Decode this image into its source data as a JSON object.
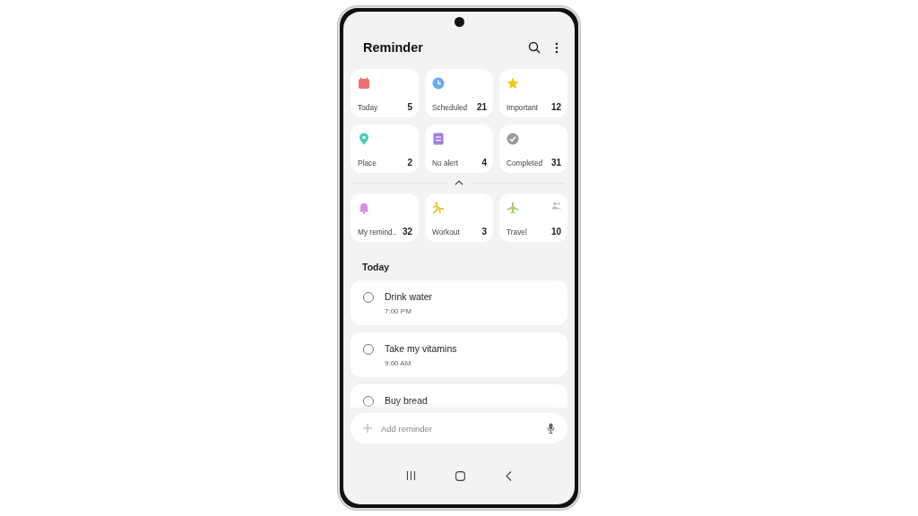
{
  "app_bar": {
    "title": "Reminder"
  },
  "categories": [
    {
      "kind": "calendar",
      "color": "#ee6e73",
      "label": "Today",
      "count": "5"
    },
    {
      "kind": "clock",
      "color": "#6aa8ef",
      "label": "Scheduled",
      "count": "21"
    },
    {
      "kind": "star",
      "color": "#f5c518",
      "label": "Important",
      "count": "12"
    },
    {
      "kind": "pin",
      "color": "#4fc9be",
      "label": "Place",
      "count": "2"
    },
    {
      "kind": "list",
      "color": "#9b7fe0",
      "label": "No alert",
      "count": "4"
    },
    {
      "kind": "check",
      "color": "#9a9a9a",
      "label": "Completed",
      "count": "31"
    }
  ],
  "collapse_expanded": true,
  "lists": [
    {
      "kind": "bell",
      "color": "#d98ce6",
      "label": "My remind..",
      "count": "32",
      "shared": false
    },
    {
      "kind": "runner",
      "color": "#e8d33a",
      "label": "Workout",
      "count": "3",
      "shared": false
    },
    {
      "kind": "plane",
      "color": "#a6cf6a",
      "label": "Travel",
      "count": "10",
      "shared": true
    }
  ],
  "section_title": "Today",
  "reminders": [
    {
      "title": "Drink water",
      "time": "7:00 PM",
      "checked": false
    },
    {
      "title": "Take my vitamins",
      "time": "9:00 AM",
      "checked": false
    },
    {
      "title": "Buy bread",
      "checked": false
    }
  ],
  "add_field": {
    "placeholder": "Add reminder"
  }
}
